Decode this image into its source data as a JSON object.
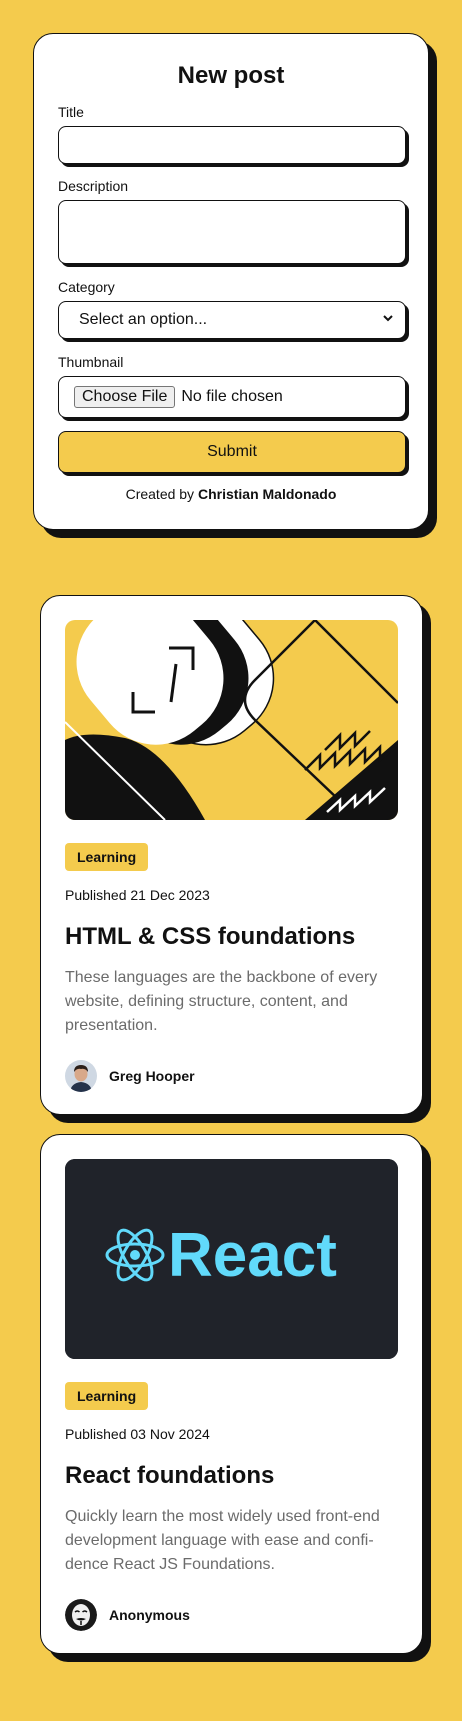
{
  "form": {
    "title": "New post",
    "labels": {
      "title": "Title",
      "description": "Description",
      "category": "Category",
      "thumbnail": "Thumbnail"
    },
    "inputs": {
      "title_value": "",
      "description_value": ""
    },
    "category_selected": "Select an option...",
    "file": {
      "button": "Choose File",
      "status": "No file chosen"
    },
    "submit_label": "Submit",
    "credit": {
      "prefix": "Created by",
      "name": "Christian Maldonado"
    }
  },
  "posts": [
    {
      "thumbnail_icon": "code-abstract-illustration",
      "tag": "Learning",
      "date": "Published 21 Dec 2023",
      "title": "HTML & CSS foundations",
      "excerpt": "These languages are the backbone of every website, defining structure, content, and presentation.",
      "author": "Greg Hooper",
      "avatar_icon": "person-avatar"
    },
    {
      "thumbnail_icon": "react-logo",
      "thumbnail_text": "React",
      "tag": "Learning",
      "date": "Published 03 Nov 2024",
      "title": "React foundations",
      "excerpt": "Quickly learn the most widely used front-end development language with ease and confi-dence React JS Foundations.",
      "author": "Anonymous",
      "avatar_icon": "anonymous-mask-avatar"
    }
  ],
  "colors": {
    "background": "#F4CB4D",
    "accent": "#F4CB4D",
    "ink": "#111111",
    "react_bg": "#20232A",
    "react_blue": "#61DAFB"
  }
}
